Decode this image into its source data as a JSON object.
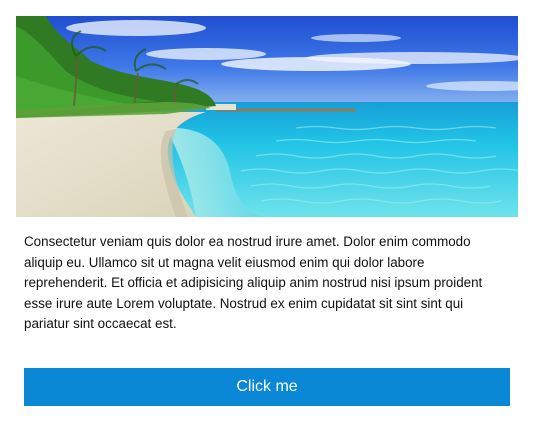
{
  "hero_image": {
    "subject": "tropical beach with palm trees and turquoise water"
  },
  "content": {
    "paragraph": "Consectetur veniam quis dolor ea nostrud irure amet. Dolor enim commodo aliquip eu. Ullamco sit ut magna velit eiusmod enim qui dolor labore reprehenderit. Et officia et adipisicing aliquip anim nostrud nisi ipsum proident esse irure aute Lorem voluptate. Nostrud ex enim cupidatat sit sint sint qui pariatur sint occaecat est."
  },
  "button": {
    "label": "Click me"
  },
  "colors": {
    "button_background": "#0a88d6",
    "button_text": "#ffffff",
    "text": "#111111"
  }
}
